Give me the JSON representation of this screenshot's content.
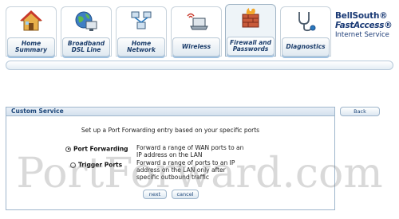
{
  "nav": {
    "tabs": [
      {
        "label": "Home Summary",
        "icon": "house-icon",
        "active": false
      },
      {
        "label": "Broadband DSL Line",
        "icon": "globe-monitor-icon",
        "active": false
      },
      {
        "label": "Home Network",
        "icon": "network-computers-icon",
        "active": false
      },
      {
        "label": "Wireless",
        "icon": "wireless-laptop-icon",
        "active": false
      },
      {
        "label": "Firewall and Passwords",
        "icon": "firewall-icon",
        "active": true
      },
      {
        "label": "Diagnostics",
        "icon": "stethoscope-icon",
        "active": false
      }
    ]
  },
  "brand": {
    "line1": "BellSouth®",
    "line2": "FastAccess®",
    "line3": "Internet Service"
  },
  "panel": {
    "title": "Custom Service",
    "intro": "Set up a Port Forwarding entry based on your specific ports",
    "options": [
      {
        "name": "Port Forwarding",
        "desc": "Forward a range of WAN ports to an IP address on the LAN",
        "selected": true
      },
      {
        "name": "Trigger Ports",
        "desc": "Forward a range of ports to an IP address on the LAN only after specific outbound traffic",
        "selected": false
      }
    ],
    "next_label": "next",
    "cancel_label": "cancel"
  },
  "back_label": "Back",
  "watermark": "PortForward.com",
  "colors": {
    "accent": "#1d477a",
    "border": "#9fb6cc",
    "tab_shadow": "#9fc1e0"
  }
}
